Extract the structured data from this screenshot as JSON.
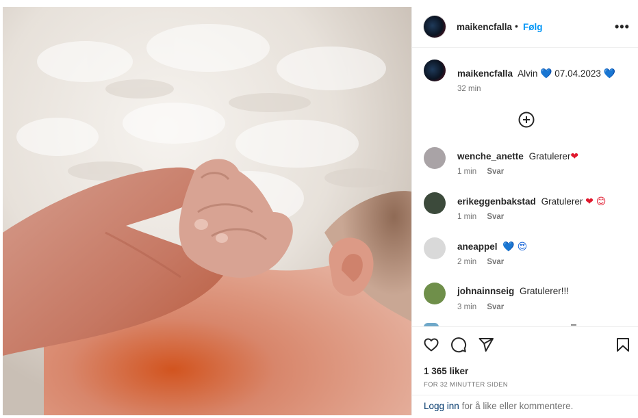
{
  "post": {
    "author": "maikencfalla",
    "separator": "•",
    "follow_label": "Følg",
    "more_icon": "more-horizontal-icon",
    "photo_alt": "Baby hand holding adult finger"
  },
  "caption": {
    "username": "maikencfalla",
    "text": "Alvin",
    "emoji_1": "💙",
    "date": "07.04.2023",
    "emoji_2": "💙",
    "time": "32 min"
  },
  "load_more_icon": "plus-circle-icon",
  "comments": [
    {
      "username": "wenche_anette",
      "text": "Gratulerer",
      "emoji": "❤",
      "time": "1 min",
      "reply": "Svar",
      "avatar_color": "#a9a3a6"
    },
    {
      "username": "erikeggenbakstad",
      "text": "Gratulerer",
      "emoji": "❤ 😊",
      "time": "1 min",
      "reply": "Svar",
      "avatar_color": "#3c4a3b"
    },
    {
      "username": "aneappel",
      "text": "",
      "emoji": "💙 😍",
      "time": "2 min",
      "reply": "Svar",
      "avatar_color": "#d9d9d9"
    },
    {
      "username": "johnainnseig",
      "text": "Gratulerer!!!",
      "emoji": "",
      "time": "3 min",
      "reply": "Svar",
      "avatar_color": "#6f8f4a"
    }
  ],
  "actions": {
    "like_icon": "heart-icon",
    "comment_icon": "comment-icon",
    "share_icon": "paper-plane-icon",
    "save_icon": "bookmark-icon"
  },
  "likes": "1 365 liker",
  "posted_ago": "FOR 32 MINUTTER SIDEN",
  "login": {
    "link": "Logg inn",
    "text": "for å like eller kommentere."
  }
}
